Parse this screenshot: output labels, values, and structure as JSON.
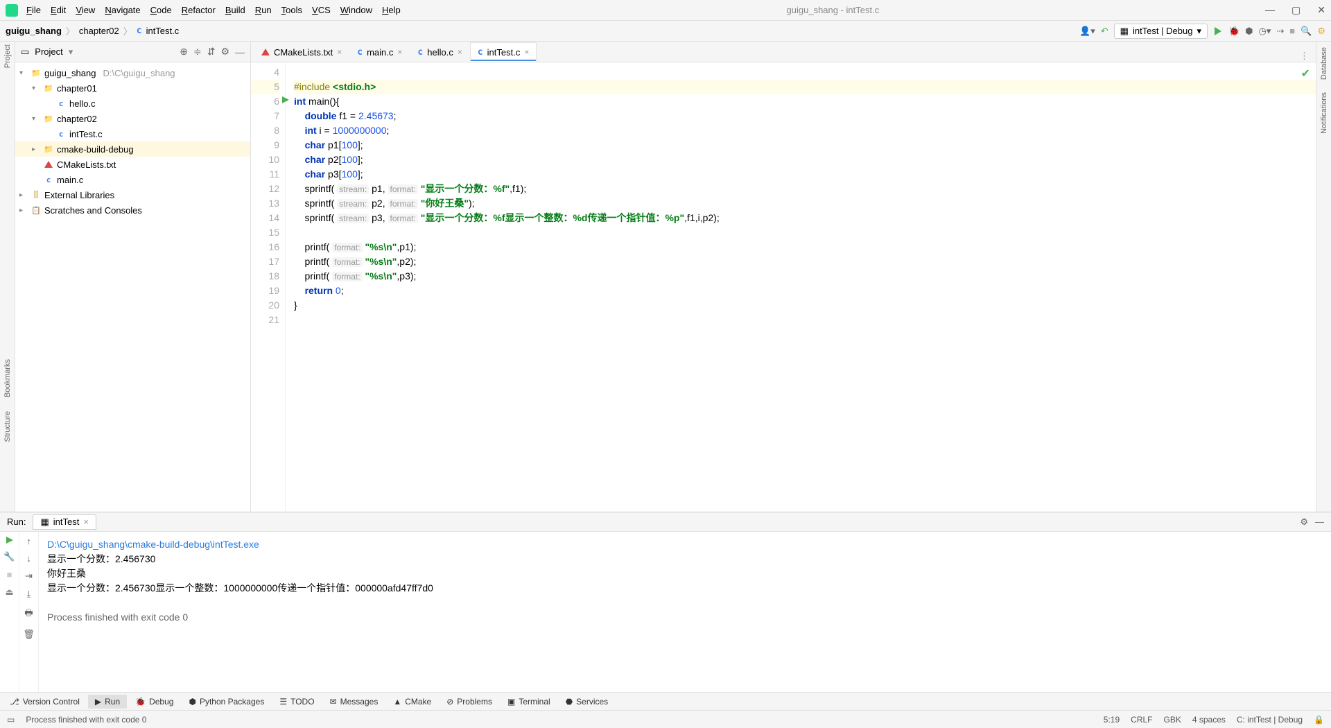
{
  "menu": [
    "File",
    "Edit",
    "View",
    "Navigate",
    "Code",
    "Refactor",
    "Build",
    "Run",
    "Tools",
    "VCS",
    "Window",
    "Help"
  ],
  "window_title": "guigu_shang - intTest.c",
  "breadcrumbs": [
    "guigu_shang",
    "chapter02",
    "intTest.c"
  ],
  "run_config": "intTest | Debug",
  "project_panel": {
    "title": "Project",
    "tree": [
      {
        "lvl": 0,
        "arrow": "▾",
        "icon": "folder",
        "name": "guigu_shang",
        "suffix": "D:\\C\\guigu_shang"
      },
      {
        "lvl": 1,
        "arrow": "▾",
        "icon": "folder",
        "name": "chapter01"
      },
      {
        "lvl": 2,
        "arrow": "",
        "icon": "c",
        "name": "hello.c"
      },
      {
        "lvl": 1,
        "arrow": "▾",
        "icon": "folder",
        "name": "chapter02"
      },
      {
        "lvl": 2,
        "arrow": "",
        "icon": "c",
        "name": "intTest.c"
      },
      {
        "lvl": 1,
        "arrow": "▸",
        "icon": "folder-orange",
        "name": "cmake-build-debug",
        "sel": true
      },
      {
        "lvl": 1,
        "arrow": "",
        "icon": "cmake",
        "name": "CMakeLists.txt"
      },
      {
        "lvl": 1,
        "arrow": "",
        "icon": "c",
        "name": "main.c"
      },
      {
        "lvl": 0,
        "arrow": "▸",
        "icon": "lib",
        "name": "External Libraries"
      },
      {
        "lvl": 0,
        "arrow": "▸",
        "icon": "scratch",
        "name": "Scratches and Consoles"
      }
    ]
  },
  "tabs": [
    {
      "icon": "cmake",
      "label": "CMakeLists.txt"
    },
    {
      "icon": "c",
      "label": "main.c"
    },
    {
      "icon": "c",
      "label": "hello.c"
    },
    {
      "icon": "c",
      "label": "intTest.c",
      "active": true
    }
  ],
  "code_lines": [
    {
      "n": 4,
      "html": ""
    },
    {
      "n": 5,
      "hl": true,
      "html": "<span class='inc'>#include</span> <span class='str'>&lt;stdio.h&gt;</span>"
    },
    {
      "n": 6,
      "run": true,
      "html": "<span class='kw'>int</span> main(){"
    },
    {
      "n": 7,
      "html": "    <span class='kw'>double</span> f1 = <span class='num'>2.45673</span>;"
    },
    {
      "n": 8,
      "html": "    <span class='kw'>int</span> i = <span class='num'>1000000000</span>;"
    },
    {
      "n": 9,
      "html": "    <span class='kw'>char</span> p1[<span class='num'>100</span>];"
    },
    {
      "n": 10,
      "html": "    <span class='kw'>char</span> p2[<span class='num'>100</span>];"
    },
    {
      "n": 11,
      "html": "    <span class='kw'>char</span> p3[<span class='num'>100</span>];"
    },
    {
      "n": 12,
      "html": "    sprintf( <span class='hint'>stream:</span> p1, <span class='hint'>format:</span> <span class='str'>\"显示一个分数：%f\"</span>,f1);"
    },
    {
      "n": 13,
      "html": "    sprintf( <span class='hint'>stream:</span> p2, <span class='hint'>format:</span> <span class='str'>\"你好王桑\"</span>);"
    },
    {
      "n": 14,
      "html": "    sprintf( <span class='hint'>stream:</span> p3, <span class='hint'>format:</span> <span class='str'>\"显示一个分数：%f显示一个整数：%d传递一个指针值：%p\"</span>,f1,i,p2);"
    },
    {
      "n": 15,
      "html": ""
    },
    {
      "n": 16,
      "html": "    printf( <span class='hint'>format:</span> <span class='str'>\"%s\\n\"</span>,p1);"
    },
    {
      "n": 17,
      "html": "    printf( <span class='hint'>format:</span> <span class='str'>\"%s\\n\"</span>,p2);"
    },
    {
      "n": 18,
      "html": "    printf( <span class='hint'>format:</span> <span class='str'>\"%s\\n\"</span>,p3);"
    },
    {
      "n": 19,
      "html": "    <span class='kw'>return</span> <span class='num'>0</span>;"
    },
    {
      "n": 20,
      "html": "}"
    },
    {
      "n": 21,
      "html": ""
    }
  ],
  "run_panel": {
    "title": "Run:",
    "tab": "intTest",
    "console": [
      {
        "cls": "path",
        "text": "D:\\C\\guigu_shang\\cmake-build-debug\\intTest.exe"
      },
      {
        "cls": "",
        "text": "显示一个分数：2.456730"
      },
      {
        "cls": "",
        "text": "你好王桑"
      },
      {
        "cls": "",
        "text": "显示一个分数：2.456730显示一个整数：1000000000传递一个指针值：000000afd47ff7d0"
      },
      {
        "cls": "",
        "text": ""
      },
      {
        "cls": "exit",
        "text": "Process finished with exit code 0"
      }
    ]
  },
  "bottom_tabs": [
    {
      "icon": "vcs",
      "label": "Version Control"
    },
    {
      "icon": "run",
      "label": "Run",
      "active": true
    },
    {
      "icon": "debug",
      "label": "Debug"
    },
    {
      "icon": "py",
      "label": "Python Packages"
    },
    {
      "icon": "todo",
      "label": "TODO"
    },
    {
      "icon": "msg",
      "label": "Messages"
    },
    {
      "icon": "cmake",
      "label": "CMake"
    },
    {
      "icon": "problem",
      "label": "Problems"
    },
    {
      "icon": "term",
      "label": "Terminal"
    },
    {
      "icon": "svc",
      "label": "Services"
    }
  ],
  "left_tabs": [
    "Project",
    "Bookmarks",
    "Structure"
  ],
  "right_tabs": [
    "Database",
    "Notifications"
  ],
  "status": {
    "msg": "Process finished with exit code 0",
    "pos": "5:19",
    "eol": "CRLF",
    "enc": "GBK",
    "indent": "4 spaces",
    "ctx": "C: intTest | Debug"
  }
}
